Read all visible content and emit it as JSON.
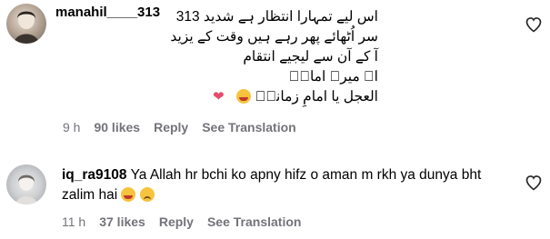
{
  "comments": [
    {
      "username": "manahil____313",
      "lines": [
        "اس لیے تمہارا انتظار ہے شدید 313",
        "سر اُٹھائے پھر رہے ہیں وقت کے یزید",
        "آ کے آن سے لیجیے انتقام",
        "اے میرے امامؑ",
        "العجل یا امامِ زمانہؑ"
      ],
      "time": "9 h",
      "likes": "90 likes",
      "reply": "Reply",
      "see_translation": "See Translation"
    },
    {
      "username": "iq_ra9108",
      "text": "Ya Allah hr bchi ko apny hifz o aman m rkh ya dunya bht zalim hai",
      "time": "11 h",
      "likes": "37 likes",
      "reply": "Reply",
      "see_translation": "See Translation"
    }
  ],
  "icons": {
    "like": "heart-outline-icon",
    "emoji_cry": "crying-face-emoji",
    "emoji_sad": "disappointed-face-emoji",
    "emoji_heart": "mending-heart-emoji"
  },
  "colors": {
    "meta_text": "#73737a",
    "text": "#000000",
    "background": "#ffffff"
  }
}
